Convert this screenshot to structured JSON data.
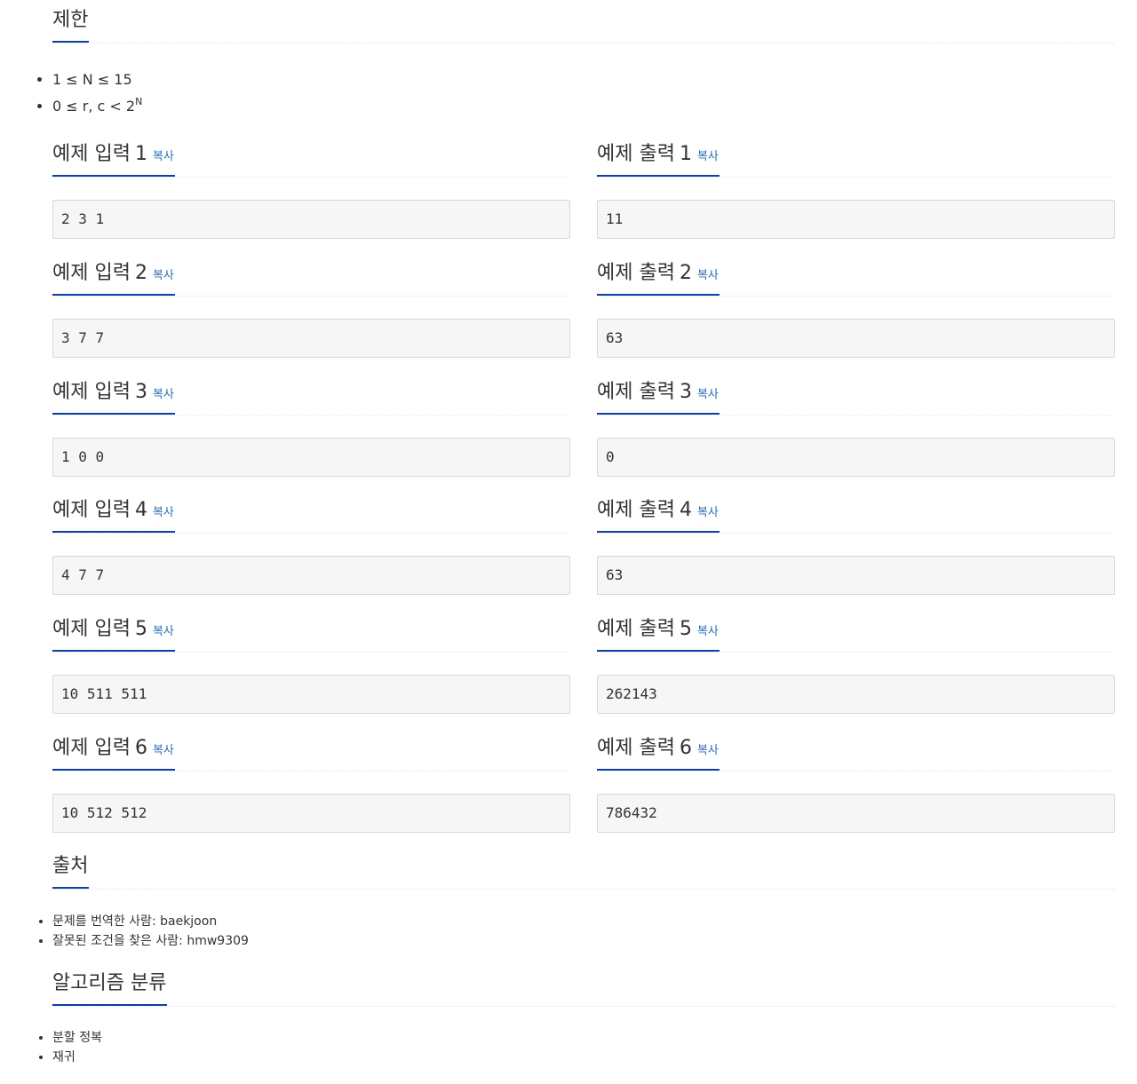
{
  "limits": {
    "title": "제한",
    "items": [
      {
        "text": "1 ≤ N ≤ 15",
        "sup": ""
      },
      {
        "text": "0 ≤ r, c < 2",
        "sup": "N"
      }
    ]
  },
  "copy_label": "복사",
  "samples": [
    {
      "input_title": "예제 입력",
      "output_title": "예제 출력",
      "num": "1",
      "input": "2 3 1",
      "output": "11"
    },
    {
      "input_title": "예제 입력",
      "output_title": "예제 출력",
      "num": "2",
      "input": "3 7 7",
      "output": "63"
    },
    {
      "input_title": "예제 입력",
      "output_title": "예제 출력",
      "num": "3",
      "input": "1 0 0",
      "output": "0"
    },
    {
      "input_title": "예제 입력",
      "output_title": "예제 출력",
      "num": "4",
      "input": "4 7 7",
      "output": "63"
    },
    {
      "input_title": "예제 입력",
      "output_title": "예제 출력",
      "num": "5",
      "input": "10 511 511",
      "output": "262143"
    },
    {
      "input_title": "예제 입력",
      "output_title": "예제 출력",
      "num": "6",
      "input": "10 512 512",
      "output": "786432"
    }
  ],
  "source": {
    "title": "출처",
    "items": [
      {
        "prefix": "문제를 번역한 사람: ",
        "user": "baekjoon"
      },
      {
        "prefix": "잘못된 조건을 찾은 사람: ",
        "user": "hmw9309"
      }
    ]
  },
  "algorithm": {
    "title": "알고리즘 분류",
    "items": [
      "분할 정복",
      "재귀"
    ]
  },
  "colors": {
    "accent": "#0d3fa6",
    "link": "#2a6db5",
    "sample_bg": "#f6f6f7"
  }
}
